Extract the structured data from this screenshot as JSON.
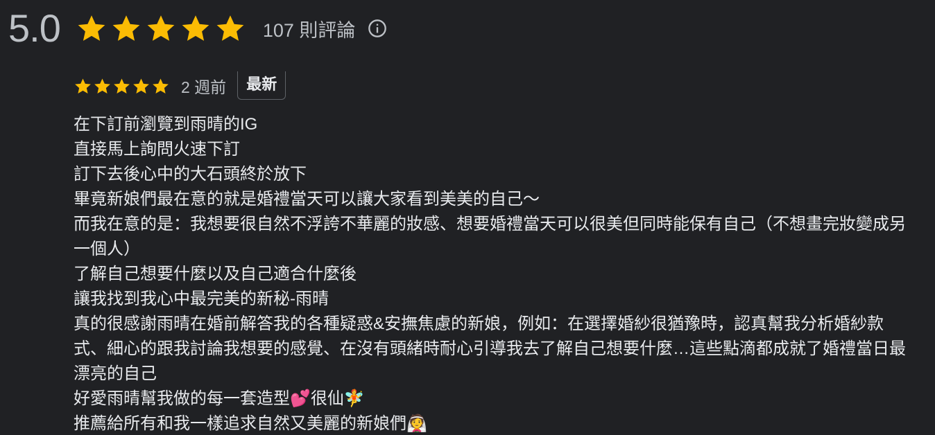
{
  "summary": {
    "rating": "5.0",
    "stars": 5,
    "review_count": "107 則評論",
    "star_color": "#fbbc04",
    "info_icon": "info-icon"
  },
  "review": {
    "stars": 5,
    "date": "2 週前",
    "badge": "最新",
    "lines": [
      "在下訂前瀏覽到雨晴的IG",
      "直接馬上詢問火速下訂",
      "訂下去後心中的大石頭終於放下",
      "畢竟新娘們最在意的就是婚禮當天可以讓大家看到美美的自己～",
      "而我在意的是：我想要很自然不浮誇不華麗的妝感、想要婚禮當天可以很美但同時能保有自己（不想畫完妝變成另一個人）",
      "了解自己想要什麼以及自己適合什麼後",
      "讓我找到我心中最完美的新秘-雨晴",
      "真的很感謝雨晴在婚前解答我的各種疑惑&安撫焦慮的新娘，例如：在選擇婚紗很猶豫時，認真幫我分析婚紗款式、細心的跟我討論我想要的感覺、在沒有頭緒時耐心引導我去了解自己想要什麼…這些點滴都成就了婚禮當日最漂亮的自己",
      "好愛雨晴幫我做的每一套造型💕很仙🧚",
      "推薦給所有和我一樣追求自然又美麗的新娘們👰"
    ]
  }
}
